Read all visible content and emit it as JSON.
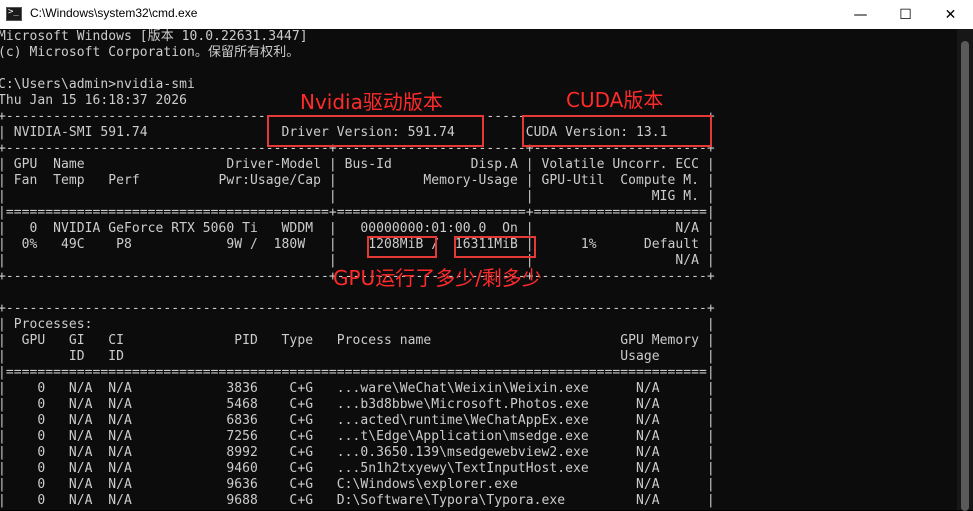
{
  "window": {
    "title": "C:\\Windows\\system32\\cmd.exe",
    "minimize_glyph": "—",
    "maximize_glyph": "☐",
    "close_glyph": "✕"
  },
  "terminal": {
    "lines": [
      "Microsoft Windows [版本 10.0.22631.3447]",
      "(c) Microsoft Corporation。保留所有权利。",
      "",
      "C:\\Users\\admin>nvidia-smi",
      "Thu Jan 15 16:18:37 2026",
      "+-----------------------------------------------------------------------------------------+",
      "| NVIDIA-SMI 591.74                 Driver Version: 591.74         CUDA Version: 13.1     |",
      "+-----------------------------------------+------------------------+----------------------+",
      "| GPU  Name                  Driver-Model | Bus-Id          Disp.A | Volatile Uncorr. ECC |",
      "| Fan  Temp   Perf          Pwr:Usage/Cap |           Memory-Usage | GPU-Util  Compute M. |",
      "|                                         |                        |               MIG M. |",
      "|=========================================+========================+======================|",
      "|   0  NVIDIA GeForce RTX 5060 Ti   WDDM  |   00000000:01:00.0  On |                  N/A |",
      "|  0%   49C    P8            9W /  180W   |    1208MiB /  16311MiB |      1%      Default |",
      "|                                         |                        |                  N/A |",
      "+-----------------------------------------+------------------------+----------------------+",
      "",
      "+-----------------------------------------------------------------------------------------+",
      "| Processes:                                                                              |",
      "|  GPU   GI   CI              PID   Type   Process name                        GPU Memory |",
      "|        ID   ID                                                               Usage      |",
      "|=========================================================================================|",
      "|    0   N/A  N/A            3836    C+G   ...ware\\WeChat\\Weixin\\Weixin.exe      N/A      |",
      "|    0   N/A  N/A            5468    C+G   ...b3d8bbwe\\Microsoft.Photos.exe      N/A      |",
      "|    0   N/A  N/A            6836    C+G   ...acted\\runtime\\WeChatAppEx.exe      N/A      |",
      "|    0   N/A  N/A            7256    C+G   ...t\\Edge\\Application\\msedge.exe      N/A      |",
      "|    0   N/A  N/A            8992    C+G   ...0.3650.139\\msedgewebview2.exe      N/A      |",
      "|    0   N/A  N/A            9460    C+G   ...5n1h2txyewy\\TextInputHost.exe      N/A      |",
      "|    0   N/A  N/A            9636    C+G   C:\\Windows\\explorer.exe               N/A      |",
      "|    0   N/A  N/A            9688    C+G   D:\\Software\\Typora\\Typora.exe         N/A      |"
    ]
  },
  "annotations": {
    "driver_label": "Nvidia驱动版本",
    "cuda_label": "CUDA版本",
    "memory_label": "GPU运行了多少/剩多少"
  },
  "colors": {
    "terminal_bg": "#0c0c0c",
    "terminal_fg": "#cccccc",
    "annotation": "#ff2a2a"
  }
}
